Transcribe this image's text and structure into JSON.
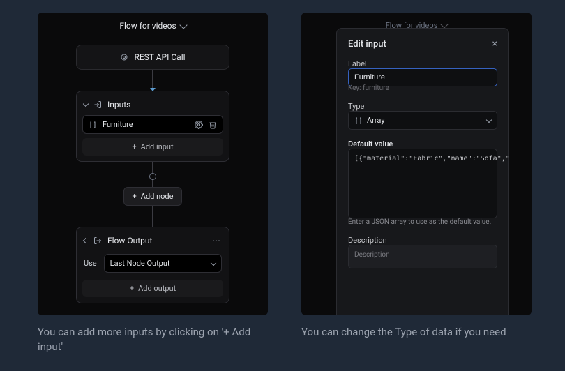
{
  "left": {
    "title": "Flow for videos",
    "rest_api_label": "REST API Call",
    "inputs": {
      "header": "Inputs",
      "item_label": "Furniture",
      "add_label": "Add input"
    },
    "add_node_label": "Add node",
    "output": {
      "header": "Flow Output",
      "use_label": "Use",
      "selected": "Last Node Output",
      "add_output_label": "Add output"
    },
    "caption": "You can add more inputs by clicking on '+ Add input'"
  },
  "right": {
    "title": "Flow for videos",
    "modal": {
      "title": "Edit input",
      "label_label": "Label",
      "label_value": "Furniture",
      "key_prefix": "Key:",
      "key_value": "furniture",
      "type_label": "Type",
      "type_value": "Array",
      "default_label": "Default value",
      "default_value": "[{\"material\":\"Fabric\",\"name\":\"Sofa\",\"",
      "default_hint": "Enter a JSON array to use as the default value.",
      "desc_label": "Description",
      "desc_placeholder": "Description"
    },
    "caption": "You can change the Type of data if you need"
  }
}
